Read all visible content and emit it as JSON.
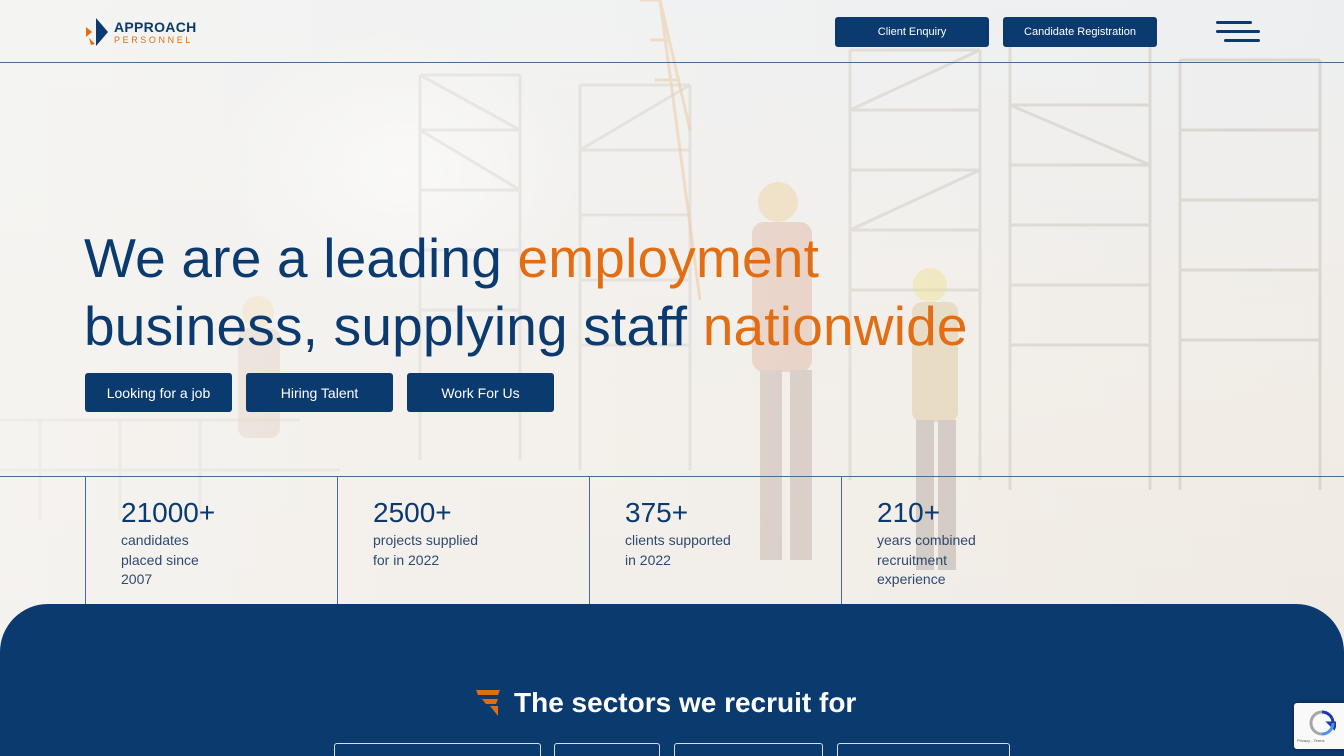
{
  "header": {
    "logo_top": "APPROACH",
    "logo_bottom": "PERSONNEL",
    "client_enquiry": "Client Enquiry",
    "candidate_registration": "Candidate Registration"
  },
  "hero": {
    "line1_plain": "We are a leading ",
    "line1_accent": "employment",
    "line2_plain": "business, supplying staff ",
    "line2_accent": "nationwide",
    "buttons": [
      "Looking for a job",
      "Hiring Talent",
      "Work For Us"
    ]
  },
  "stats": [
    {
      "value": "21000+",
      "label": "candidates placed since 2007"
    },
    {
      "value": "2500+",
      "label": "projects supplied for in 2022"
    },
    {
      "value": "375+",
      "label": "clients supported in 2022"
    },
    {
      "value": "210+",
      "label": "years combined recruitment experience"
    }
  ],
  "sectors": {
    "title": "The sectors we recruit for"
  },
  "recaptcha": {
    "text": "Privacy - Terms"
  },
  "colors": {
    "brand_blue": "#0b3a6e",
    "accent_orange": "#e36d12"
  }
}
